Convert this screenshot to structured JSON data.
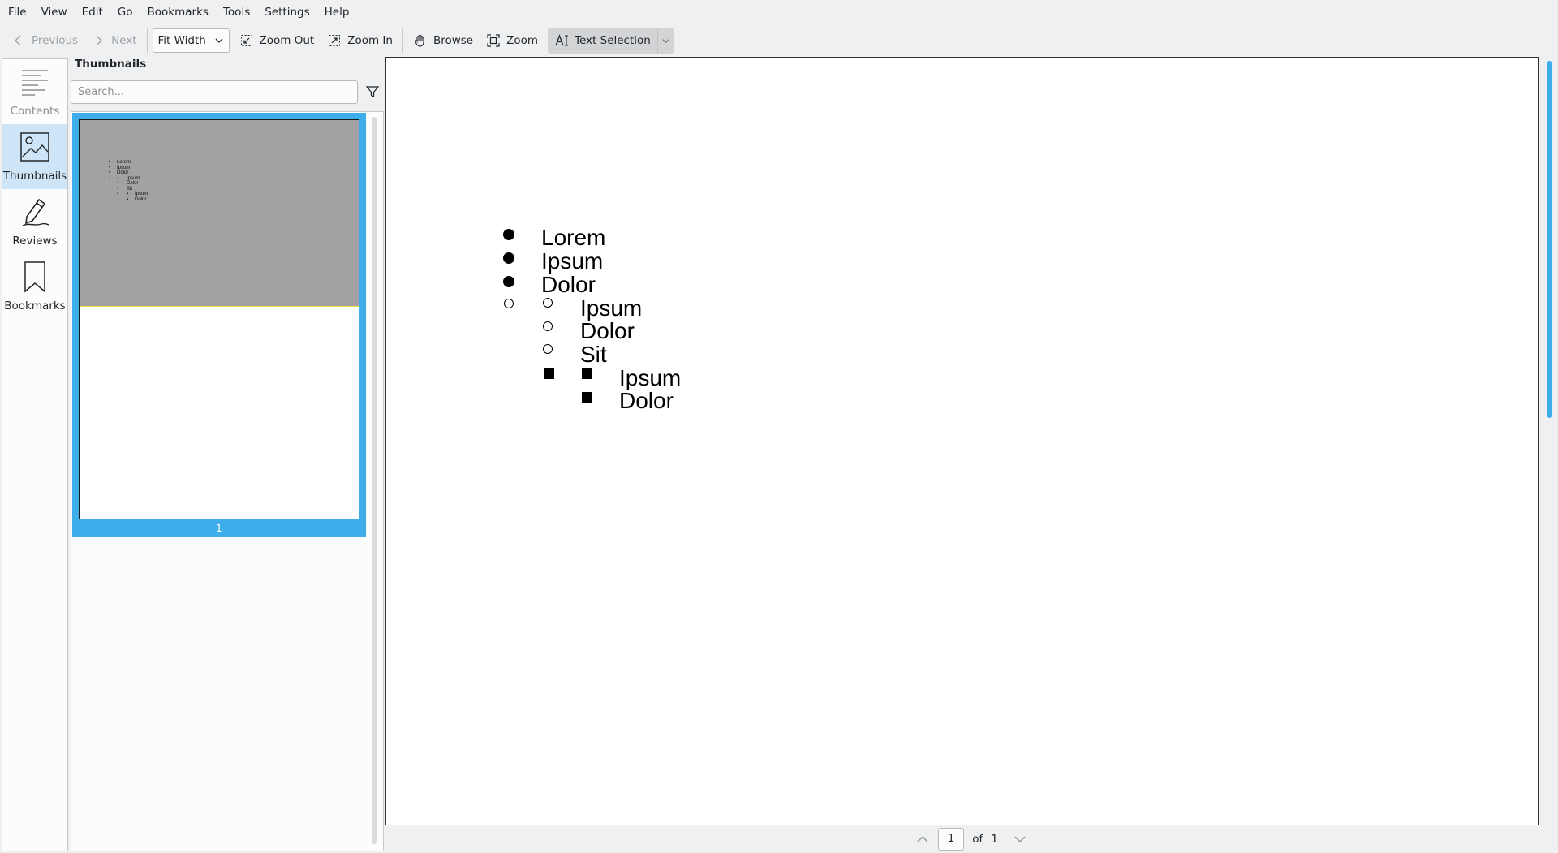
{
  "menubar": {
    "items": [
      "File",
      "View",
      "Edit",
      "Go",
      "Bookmarks",
      "Tools",
      "Settings",
      "Help"
    ]
  },
  "toolbar": {
    "previous_label": "Previous",
    "next_label": "Next",
    "zoom_mode": "Fit Width",
    "zoom_out_label": "Zoom Out",
    "zoom_in_label": "Zoom In",
    "browse_label": "Browse",
    "zoom_label": "Zoom",
    "text_selection_label": "Text Selection"
  },
  "sidebar": {
    "items": [
      {
        "label": "Contents",
        "icon": "contents-icon"
      },
      {
        "label": "Thumbnails",
        "icon": "thumbnails-icon"
      },
      {
        "label": "Reviews",
        "icon": "reviews-icon"
      },
      {
        "label": "Bookmarks",
        "icon": "bookmarks-icon"
      }
    ],
    "selected": "Thumbnails"
  },
  "thumbnails_panel": {
    "title": "Thumbnails",
    "search_placeholder": "Search...",
    "pages": [
      {
        "number": "1"
      }
    ]
  },
  "document": {
    "list": [
      {
        "text": "Lorem"
      },
      {
        "text": "Ipsum"
      },
      {
        "text": "Dolor"
      },
      {
        "text": "Ipsum"
      },
      {
        "text": "Dolor"
      },
      {
        "text": "Sit"
      },
      {
        "text": "Ipsum"
      },
      {
        "text": "Dolor"
      }
    ]
  },
  "pagebar": {
    "current_page": "1",
    "of_label": "of",
    "total_pages": "1"
  },
  "colors": {
    "accent": "#3daee9",
    "selected_bg": "#cde5f7",
    "window_bg": "#eff0f1"
  }
}
